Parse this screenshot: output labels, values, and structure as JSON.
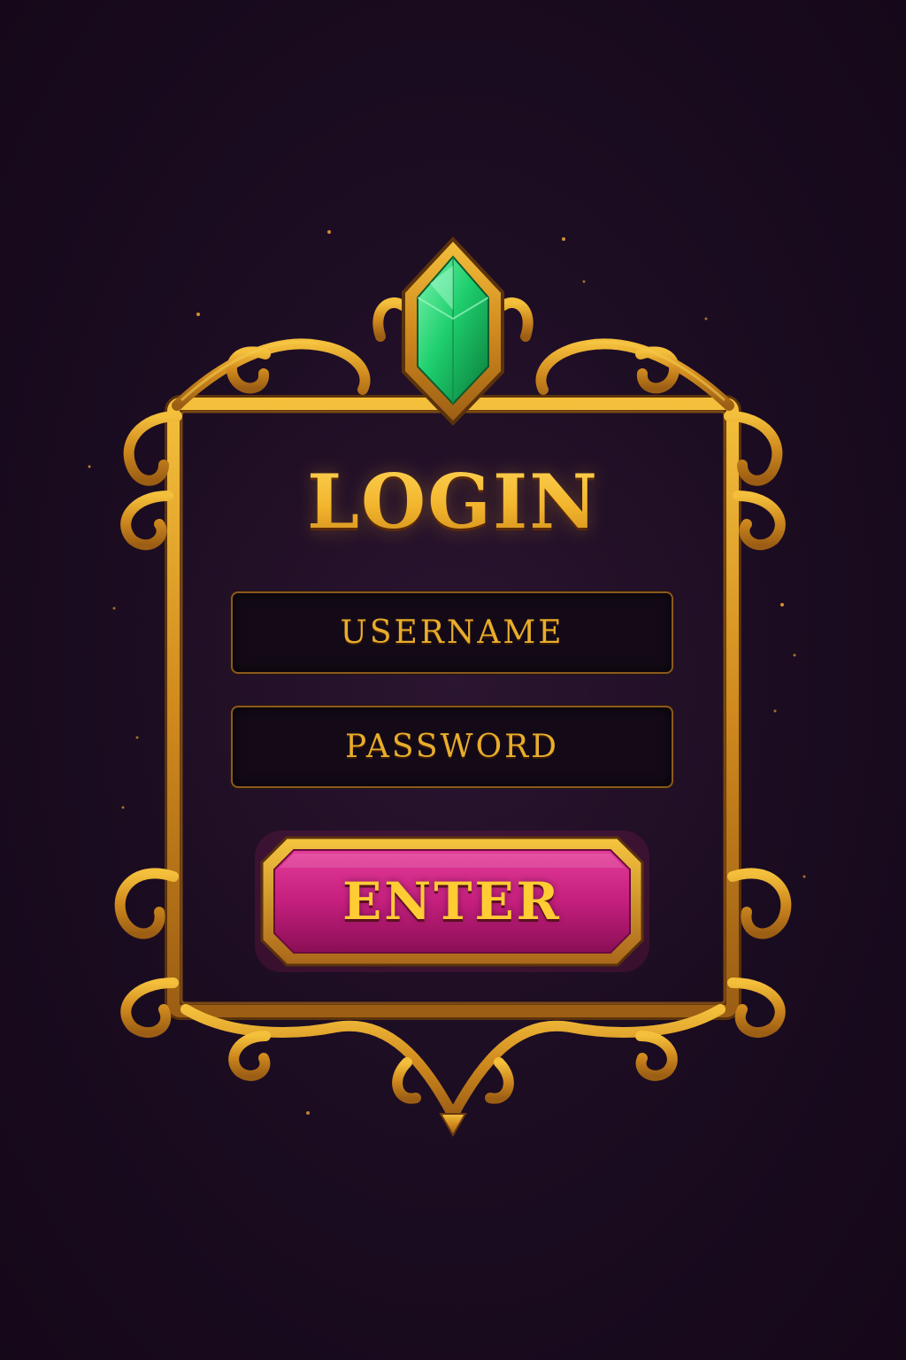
{
  "screen": {
    "title": "LOGIN",
    "username_placeholder": "USERNAME",
    "password_placeholder": "PASSWORD",
    "enter_label": "ENTER"
  },
  "icons": {
    "top_gem": "emerald-gem-icon",
    "frame": "ornate-gold-frame"
  },
  "colors": {
    "background": "#190b1f",
    "gold": "#e8ad2c",
    "gold_dark": "#8a5a1c",
    "gem_green": "#22d67a",
    "button_magenta": "#c51f7e",
    "field_bg": "#140a17"
  }
}
